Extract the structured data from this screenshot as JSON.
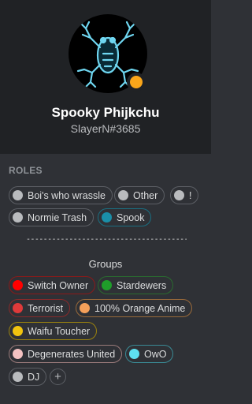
{
  "profile": {
    "username": "Spooky Phijkchu",
    "tag": "SlayerN#3685",
    "status_color": "#faa61a"
  },
  "roles": {
    "title": "ROLES",
    "items": [
      {
        "label": "Boi's who wrassle",
        "color": "#b9bbbe",
        "border": "#5c5f65"
      },
      {
        "label": "Other",
        "color": "#b9bbbe",
        "border": "#5c5f65"
      },
      {
        "label": "!",
        "color": "#b9bbbe",
        "border": "#5c5f65"
      },
      {
        "label": "Normie Trash",
        "color": "#b9bbbe",
        "border": "#5c5f65"
      },
      {
        "label": "Spook",
        "color": "#1a8fa8",
        "border": "#1a6f82"
      }
    ],
    "separator": "----------------------------------------------------",
    "groups_title": "Groups",
    "groups": [
      {
        "label": "Switch Owner",
        "color": "#ff0000",
        "border": "#8a1a1a"
      },
      {
        "label": "Stardewers",
        "color": "#1f9d2a",
        "border": "#2a6b2f"
      },
      {
        "label": "Terrorist",
        "color": "#e03a3a",
        "border": "#8a2a2a"
      },
      {
        "label": "100% Orange Anime",
        "color": "#f5a05a",
        "border": "#9a6a3a"
      },
      {
        "label": "Waifu Toucher",
        "color": "#f1c40f",
        "border": "#9a820f"
      },
      {
        "label": "Degenerates United",
        "color": "#f4c2c2",
        "border": "#9a7a7a"
      },
      {
        "label": "OwO",
        "color": "#5ee0f0",
        "border": "#3a8a95"
      },
      {
        "label": "DJ",
        "color": "#b9bbbe",
        "border": "#5c5f65"
      }
    ],
    "add_label": "+"
  }
}
